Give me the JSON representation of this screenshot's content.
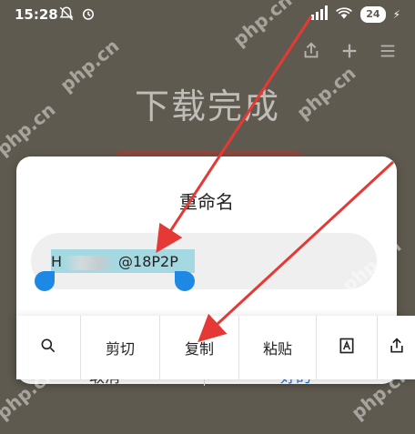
{
  "status_bar": {
    "time": "15:28",
    "battery": "24",
    "icons_left": [
      "bell-off-icon",
      "alarm-icon"
    ],
    "icons_right": [
      "hd-signal-icon",
      "wifi-icon",
      "battery-icon",
      "charging-icon"
    ]
  },
  "app_bar": {
    "title": "下载完成",
    "icons": [
      "share-icon",
      "add-icon",
      "menu-icon"
    ]
  },
  "dialog": {
    "title": "重命名",
    "filename_prefix": "H",
    "filename_suffix": "@18P2P",
    "cancel_label": "取消",
    "ok_label": "好的"
  },
  "toolbar": {
    "search_icon": "search-icon",
    "cut_label": "剪切",
    "copy_label": "复制",
    "paste_label": "粘贴",
    "text_icon": "text-format-icon",
    "share_icon": "share-up-icon"
  },
  "watermark": "php.cn",
  "colors": {
    "background": "#5f5a4f",
    "selection": "#a4d9e1",
    "handle": "#1e88e5",
    "ok_button": "#1a73e8",
    "arrow": "#e53935"
  }
}
